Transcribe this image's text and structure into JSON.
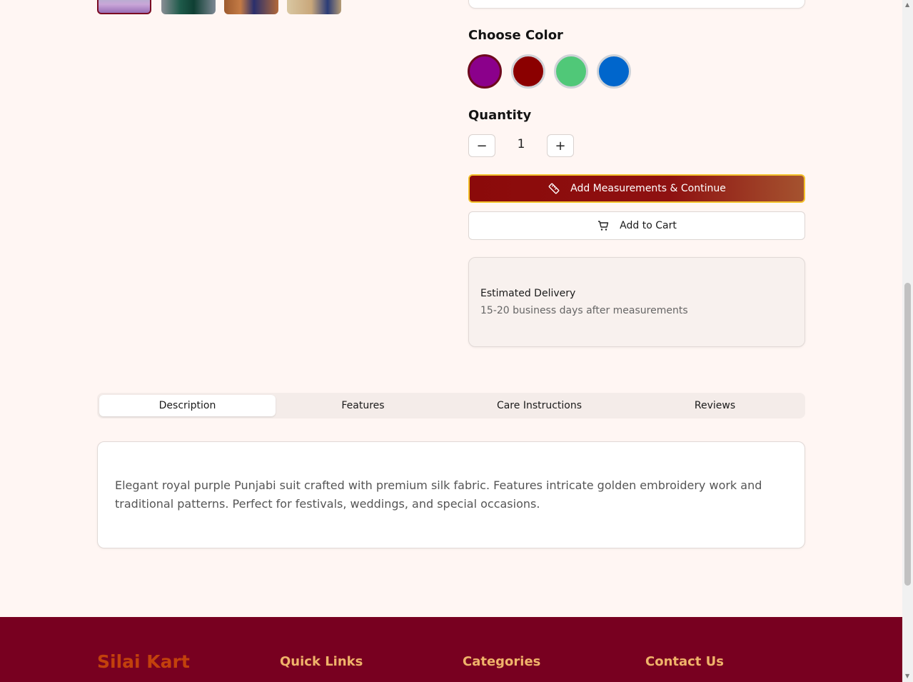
{
  "gallery": {
    "thumbnails": [
      "thumbnail-1",
      "thumbnail-2",
      "thumbnail-3",
      "thumbnail-4"
    ],
    "selected_index": 0
  },
  "color_section": {
    "title": "Choose Color",
    "colors": [
      {
        "name": "purple",
        "hex": "#8b008b",
        "selected": true
      },
      {
        "name": "maroon",
        "hex": "#8b0000",
        "selected": false
      },
      {
        "name": "green",
        "hex": "#50c878",
        "selected": false
      },
      {
        "name": "blue",
        "hex": "#0066cc",
        "selected": false
      }
    ]
  },
  "quantity_section": {
    "title": "Quantity",
    "decrement": "−",
    "increment": "+",
    "value": "1"
  },
  "actions": {
    "measure_label": "Add Measurements & Continue",
    "cart_label": "Add to Cart",
    "measure_icon": "ruler-icon",
    "cart_icon": "cart-icon"
  },
  "delivery": {
    "title": "Estimated Delivery",
    "detail": "15-20 business days after measurements"
  },
  "tabs": {
    "items": [
      "Description",
      "Features",
      "Care Instructions",
      "Reviews"
    ],
    "active": "Description"
  },
  "description": {
    "text": "Elegant royal purple Punjabi suit crafted with premium silk fabric. Features intricate golden embroidery work and traditional patterns. Perfect for festivals, weddings, and special occasions."
  },
  "footer": {
    "brand": "Silai Kart",
    "quick_links": "Quick Links",
    "categories": "Categories",
    "contact": "Contact Us"
  },
  "colors": {
    "page_bg": "#fff6f3",
    "footer_bg": "#780020",
    "brand": "#c2410c",
    "footer_heading": "#f0b36a",
    "accent_border": "#f3c12a"
  }
}
